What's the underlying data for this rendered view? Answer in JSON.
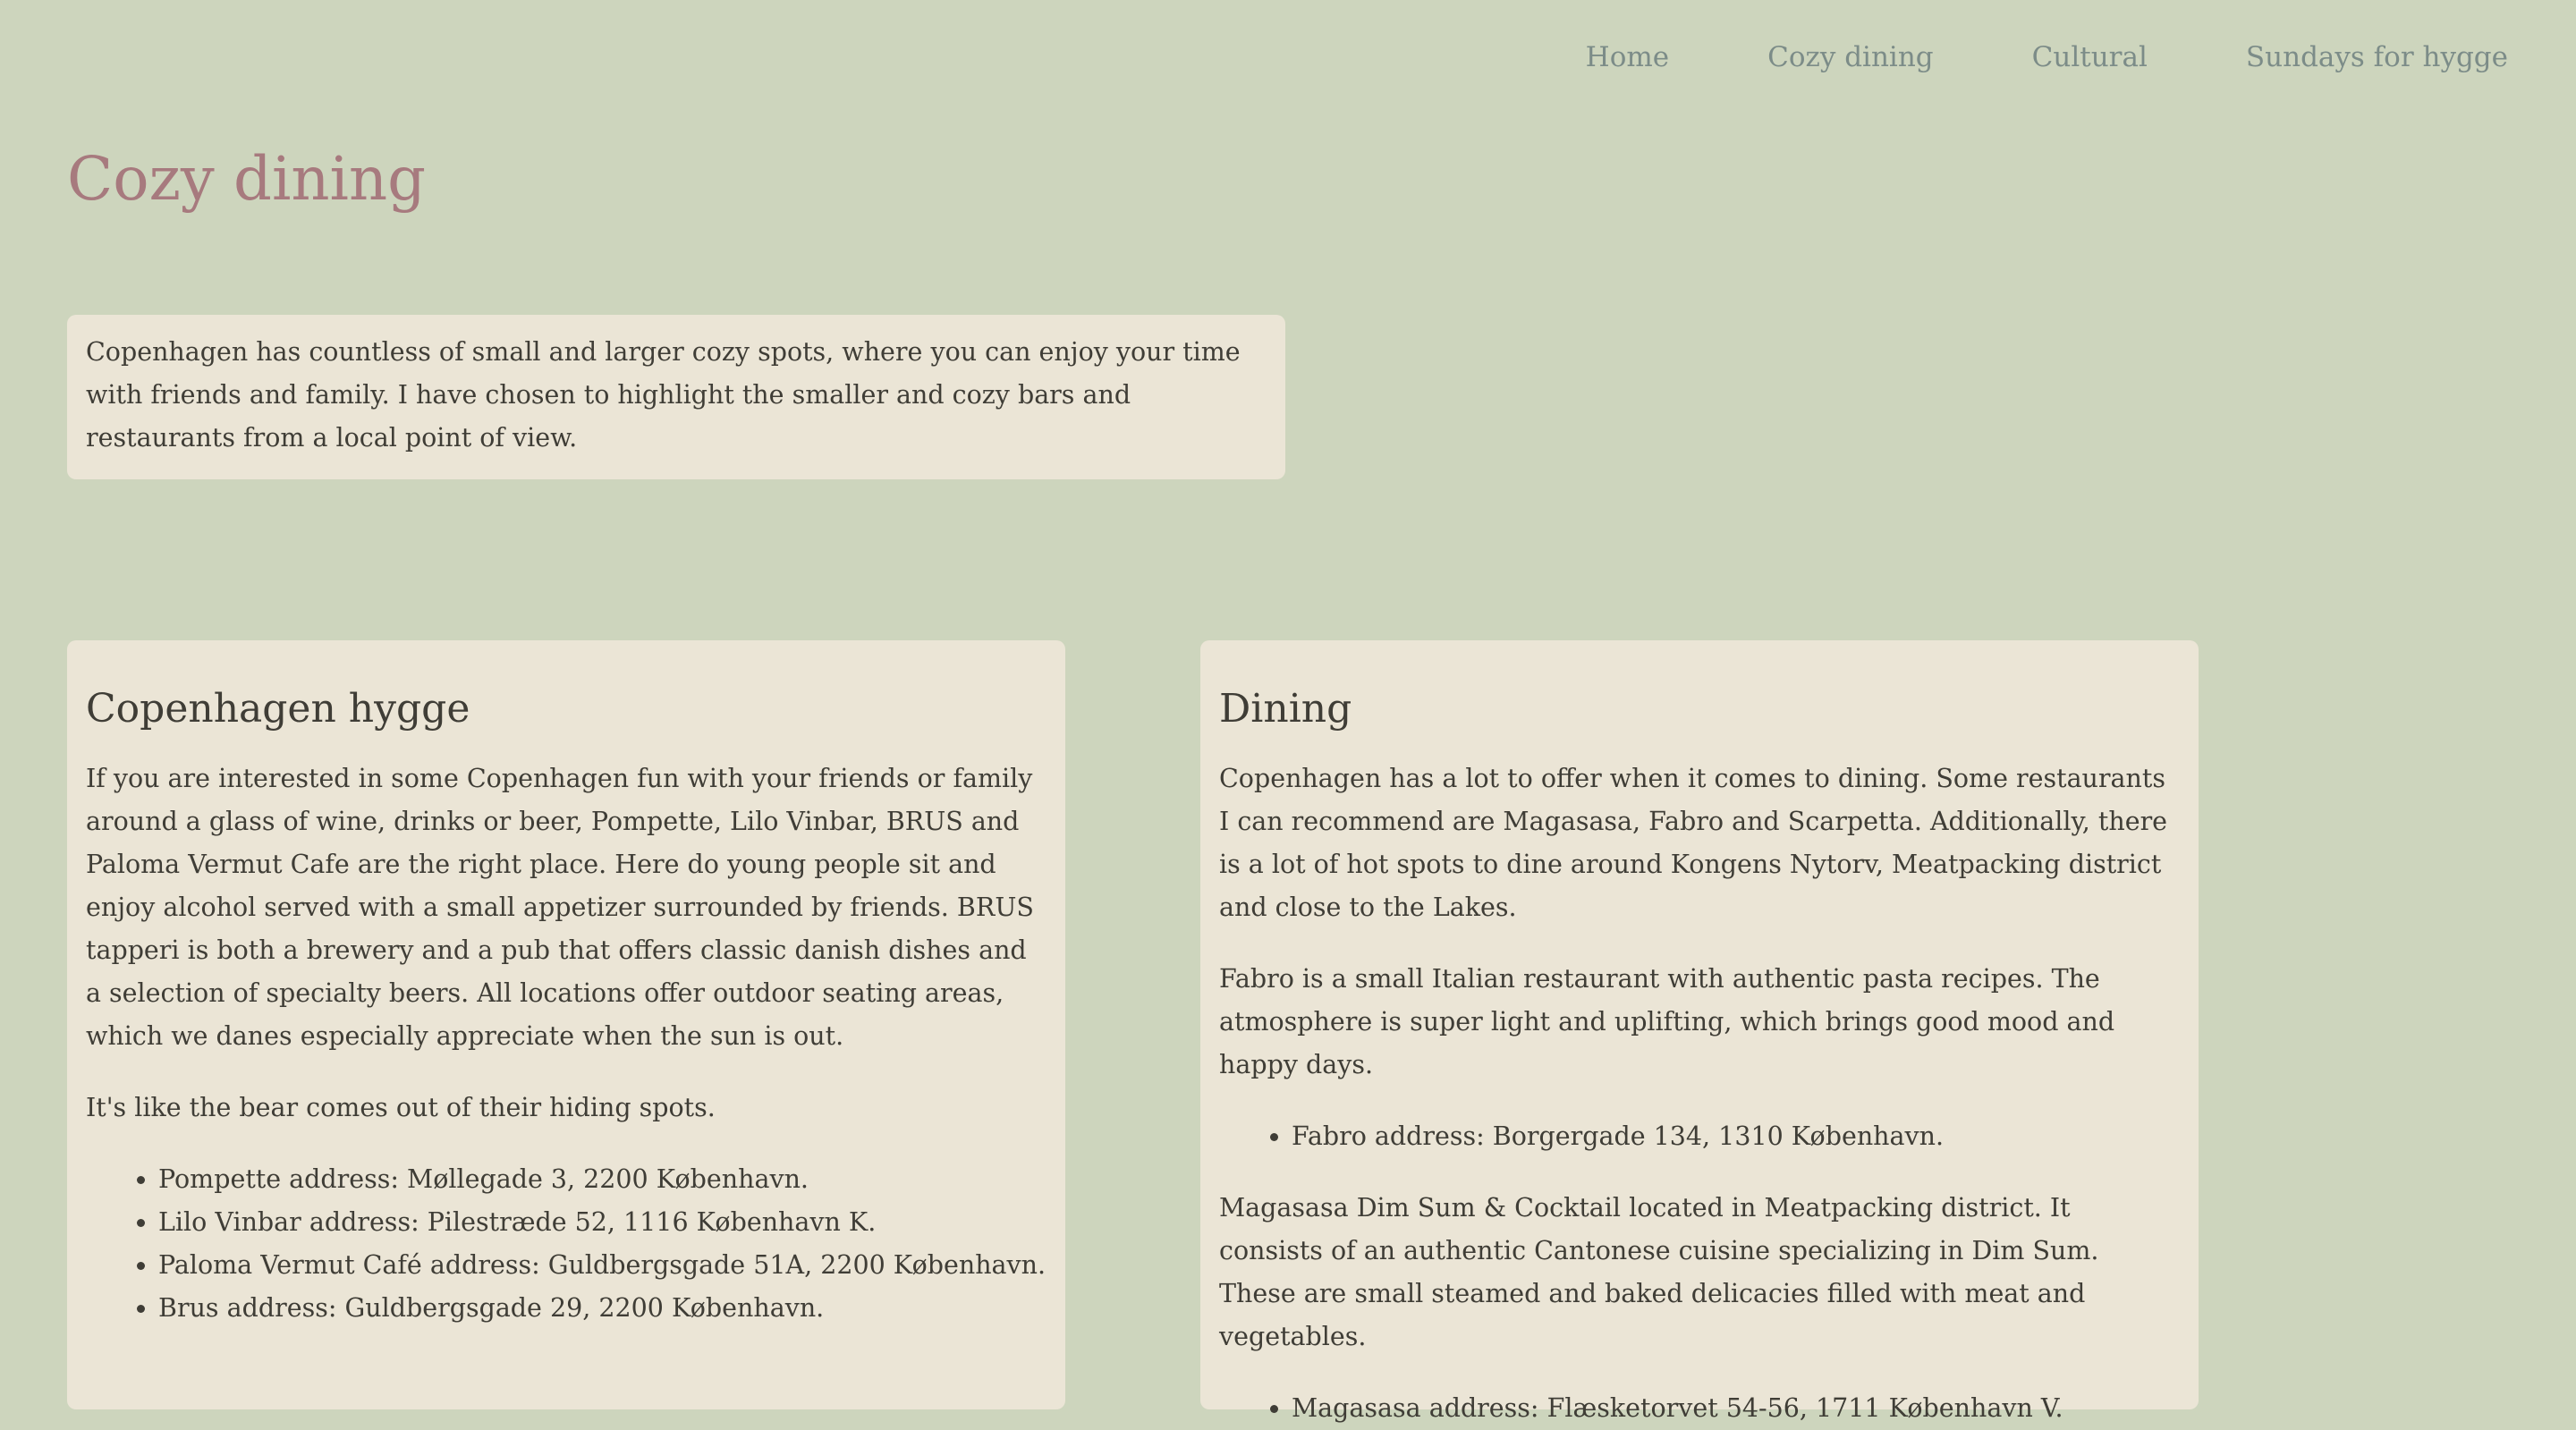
{
  "nav": {
    "items": [
      {
        "label": "Home"
      },
      {
        "label": "Cozy dining"
      },
      {
        "label": "Cultural"
      },
      {
        "label": "Sundays for hygge"
      }
    ]
  },
  "page": {
    "title": "Cozy dining",
    "intro": "Copenhagen has countless of small and larger cozy spots, where you can enjoy your time with friends and family. I have chosen to highlight the smaller and cozy bars and restaurants from a local point of view."
  },
  "hygge": {
    "heading": "Copenhagen hygge",
    "paragraph1": "If you are interested in some Copenhagen fun with your friends or family around a glass of wine, drinks or beer, Pompette, Lilo Vinbar, BRUS and Paloma Vermut Cafe are the right place. Here do young people sit and enjoy alcohol served with a small appetizer surrounded by friends. BRUS tapperi is both a brewery and a pub that offers classic danish dishes and a selection of specialty beers. All locations offer outdoor seating areas, which we danes especially appreciate when the sun is out.",
    "paragraph2": "It's like the bear comes out of their hiding spots.",
    "addresses": [
      "Pompette address: Møllegade 3, 2200 København.",
      "Lilo Vinbar address: Pilestræde 52, 1116 København K.",
      "Paloma Vermut Café address: Guldbergsgade 51A, 2200 København.",
      "Brus address: Guldbergsgade 29, 2200 København."
    ]
  },
  "dining": {
    "heading": "Dining",
    "paragraph1": "Copenhagen has a lot to offer when it comes to dining. Some restaurants I can recommend are Magasasa, Fabro and Scarpetta. Additionally, there is a lot of hot spots to dine around Kongens Nytorv, Meatpacking district and close to the Lakes.",
    "paragraph2": "Fabro is a small Italian restaurant with authentic pasta recipes. The atmosphere is super light and uplifting, which brings good mood and happy days.",
    "fabro_address": "Fabro address: Borgergade 134, 1310 København.",
    "paragraph3": "Magasasa Dim Sum & Cocktail located in Meatpacking district. It consists of an authentic Cantonese cuisine specializing in Dim Sum. These are small steamed and baked delicacies filled with meat and vegetables.",
    "magasasa_address": "Magasasa address: Flæsketorvet 54-56, 1711 København V."
  }
}
